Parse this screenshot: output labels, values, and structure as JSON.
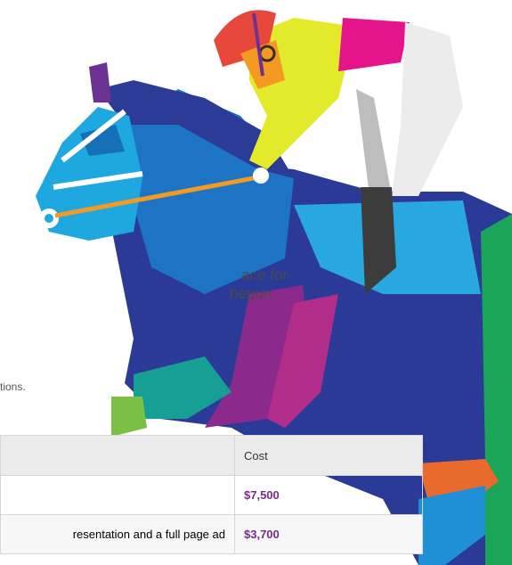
{
  "intro": {
    "line1": "ace for",
    "line2": "begun."
  },
  "note": "tions.",
  "table": {
    "header": {
      "description": "",
      "cost": "Cost"
    },
    "rows": [
      {
        "description": "",
        "cost": "$7,500"
      },
      {
        "description": "resentation and a full page ad",
        "cost": "$3,700"
      }
    ]
  },
  "colors": {
    "horse_blue": "#2b3a97",
    "horse_light": "#1fa8df",
    "jockey_yellow": "#e3ea2a",
    "jockey_pink": "#e6148a",
    "helmet_red": "#e8473c",
    "cost_purple": "#7b2a8a"
  },
  "icons": [
    "horse-and-jockey-illustration"
  ]
}
